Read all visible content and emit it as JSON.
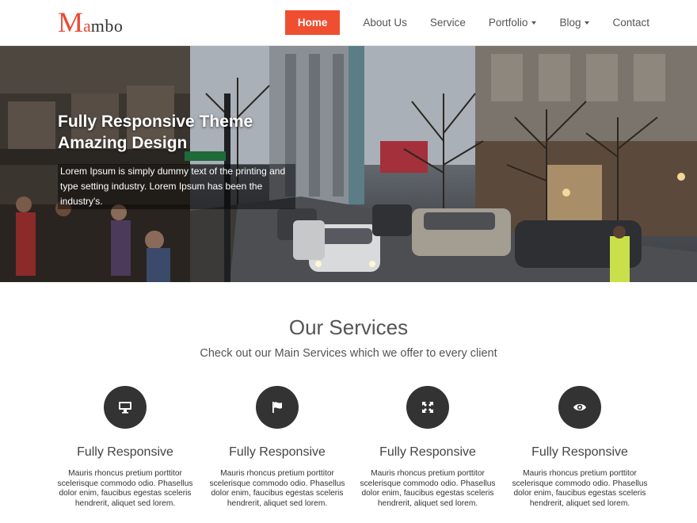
{
  "brand": {
    "logo_big": "M",
    "logo_a": "a",
    "logo_rest": "mbo"
  },
  "nav": {
    "items": [
      {
        "label": "Home"
      },
      {
        "label": "About Us"
      },
      {
        "label": "Service"
      },
      {
        "label": "Portfolio"
      },
      {
        "label": "Blog"
      },
      {
        "label": "Contact"
      }
    ]
  },
  "hero": {
    "title_line1": "Fully Responsive Theme",
    "title_line2": "Amazing Design",
    "description": "Lorem Ipsum is simply dummy text of the printing and type setting industry. Lorem Ipsum has been the industry's."
  },
  "services": {
    "title": "Our Services",
    "subtitle": "Check out our Main Services which we offer to every client",
    "items": [
      {
        "icon": "desktop-icon",
        "title": "Fully Responsive",
        "text": "Mauris rhoncus pretium porttitor scelerisque commodo odio. Phasellus dolor enim, faucibus egestas sceleris hendrerit, aliquet sed lorem."
      },
      {
        "icon": "flag-icon",
        "title": "Fully Responsive",
        "text": "Mauris rhoncus pretium porttitor scelerisque commodo odio. Phasellus dolor enim, faucibus egestas sceleris hendrerit, aliquet sed lorem."
      },
      {
        "icon": "expand-icon",
        "title": "Fully Responsive",
        "text": "Mauris rhoncus pretium porttitor scelerisque commodo odio. Phasellus dolor enim, faucibus egestas sceleris hendrerit, aliquet sed lorem."
      },
      {
        "icon": "eye-icon",
        "title": "Fully Responsive",
        "text": "Mauris rhoncus pretium porttitor scelerisque commodo odio. Phasellus dolor enim, faucibus egestas sceleris hendrerit, aliquet sed lorem."
      }
    ]
  },
  "colors": {
    "accent": "#f04e30",
    "logo": "#e84a36",
    "icon_circle": "#333333"
  }
}
